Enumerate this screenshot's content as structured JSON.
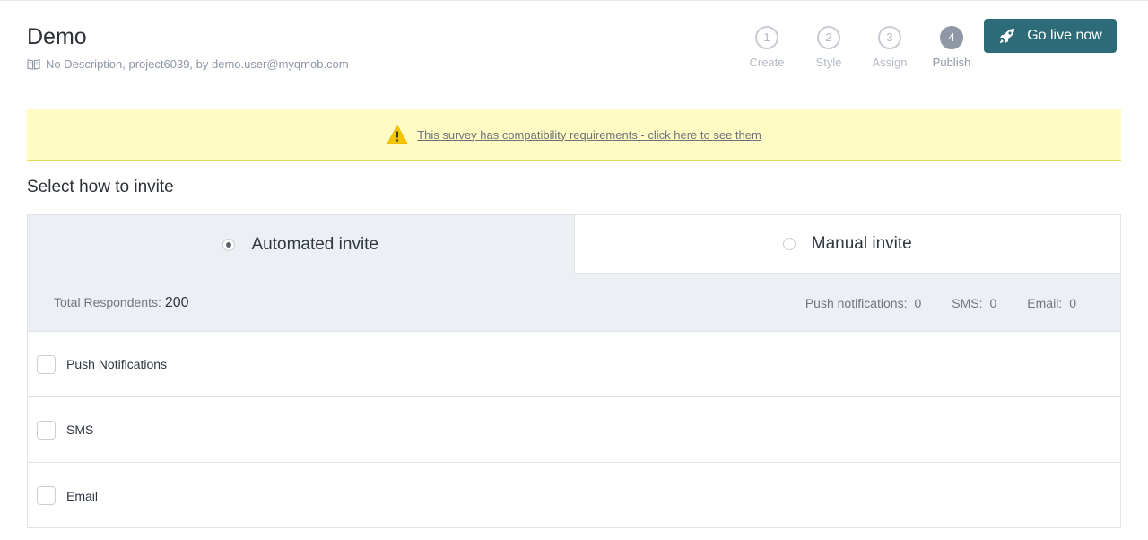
{
  "header": {
    "title": "Demo",
    "subtitle": "No Description, project6039, by demo.user@myqmob.com",
    "subtitle_icon": "book-icon"
  },
  "steps": [
    {
      "number": "1",
      "label": "Create",
      "active": false
    },
    {
      "number": "2",
      "label": "Style",
      "active": false
    },
    {
      "number": "3",
      "label": "Assign",
      "active": false
    },
    {
      "number": "4",
      "label": "Publish",
      "active": true
    }
  ],
  "go_live": {
    "label": "Go live now",
    "icon": "rocket-icon",
    "color": "#2e6b78"
  },
  "banner": {
    "text": "This survey has compatibility requirements - click here to see them",
    "icon": "warning-icon",
    "background": "#fffbc2"
  },
  "section_title": "Select how to invite",
  "tabs": [
    {
      "label": "Automated invite",
      "selected": true
    },
    {
      "label": "Manual invite",
      "selected": false
    }
  ],
  "stats": {
    "total_label": "Total Respondents:",
    "total_value": "200",
    "push_label": "Push notifications:",
    "push_value": "0",
    "sms_label": "SMS:",
    "sms_value": "0",
    "email_label": "Email:",
    "email_value": "0"
  },
  "options": [
    {
      "label": "Push Notifications",
      "checked": false
    },
    {
      "label": "SMS",
      "checked": false
    },
    {
      "label": "Email",
      "checked": false
    }
  ]
}
